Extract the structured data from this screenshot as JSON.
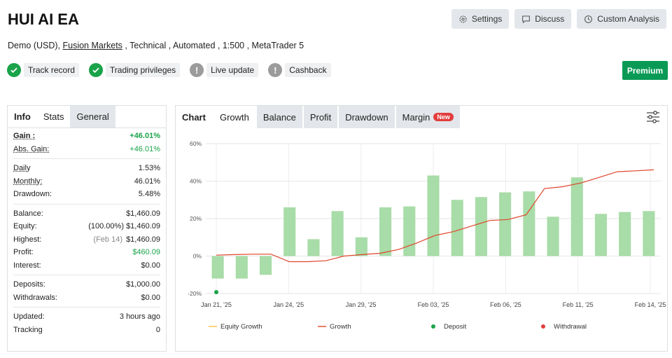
{
  "header": {
    "title": "HUI AI EA",
    "sub_prefix": "Demo (USD), ",
    "sub_link": "Fusion Markets",
    "sub_suffix": " , Technical , Automated , 1:500 , MetaTrader 5"
  },
  "top_buttons": {
    "settings": "Settings",
    "discuss": "Discuss",
    "custom": "Custom Analysis"
  },
  "badges": {
    "track": "Track record",
    "trading": "Trading privileges",
    "live": "Live update",
    "cashback": "Cashback"
  },
  "premium_label": "Premium",
  "info_tabs": {
    "info": "Info",
    "stats": "Stats",
    "general": "General"
  },
  "stats": {
    "gain_k": "Gain :",
    "gain_v": "+46.01%",
    "absgain_k": "Abs. Gain:",
    "absgain_v": "+46.01%",
    "daily_k": "Daily",
    "daily_v": "1.53%",
    "monthly_k": "Monthly:",
    "monthly_v": "46.01%",
    "drawdown_k": "Drawdown:",
    "drawdown_v": "5.48%",
    "balance_k": "Balance:",
    "balance_v": "$1,460.09",
    "equity_k": "Equity:",
    "equity_pct": "(100.00%)",
    "equity_v": "$1,460.09",
    "highest_k": "Highest:",
    "highest_date": "(Feb 14)",
    "highest_v": "$1,460.09",
    "profit_k": "Profit:",
    "profit_v": "$460.09",
    "interest_k": "Interest:",
    "interest_v": "$0.00",
    "deposits_k": "Deposits:",
    "deposits_v": "$1,000.00",
    "withdrawals_k": "Withdrawals:",
    "withdrawals_v": "$0.00",
    "updated_k": "Updated:",
    "updated_v": "3 hours ago",
    "tracking_k": "Tracking",
    "tracking_v": "0"
  },
  "chart_tabs": {
    "chart": "Chart",
    "growth": "Growth",
    "balance": "Balance",
    "profit": "Profit",
    "drawdown": "Drawdown",
    "margin": "Margin",
    "new": "New"
  },
  "colors": {
    "bar": "#a8dca8",
    "growth_line": "#e0442a",
    "equity_line": "#f5c242",
    "deposit": "#1aa34a",
    "withdrawal": "#e23d3d",
    "premium": "#0a9a55"
  },
  "chart_data": {
    "type": "bar",
    "y_ticks": [
      "60%",
      "40%",
      "20%",
      "0%",
      "-20%"
    ],
    "y_tick_values": [
      60,
      40,
      20,
      0,
      -20
    ],
    "ylim": [
      -20,
      60
    ],
    "x_tick_labels": [
      "Jan 21, '25",
      "Jan 24, '25",
      "Jan 29, '25",
      "Feb 03, '25",
      "Feb 06, '25",
      "Feb 11, '25",
      "Feb 14, '25"
    ],
    "bars": [
      -12,
      -12,
      -10,
      26,
      9,
      24,
      10,
      26,
      26.5,
      43,
      30,
      31.5,
      34,
      34.5,
      21,
      42,
      22.5,
      23.5,
      24
    ],
    "growth": [
      0.5,
      0.8,
      1.0,
      1.0,
      -3.0,
      -3.0,
      -2.5,
      0.0,
      0.8,
      1.5,
      3.5,
      7,
      11,
      13,
      16,
      19,
      19.5,
      22,
      36,
      37,
      39,
      42,
      45,
      45.5,
      46.01
    ],
    "deposit_points": [
      {
        "x": 0,
        "y": -20
      }
    ],
    "legend": [
      "Equity Growth",
      "Growth",
      "Deposit",
      "Withdrawal"
    ]
  }
}
